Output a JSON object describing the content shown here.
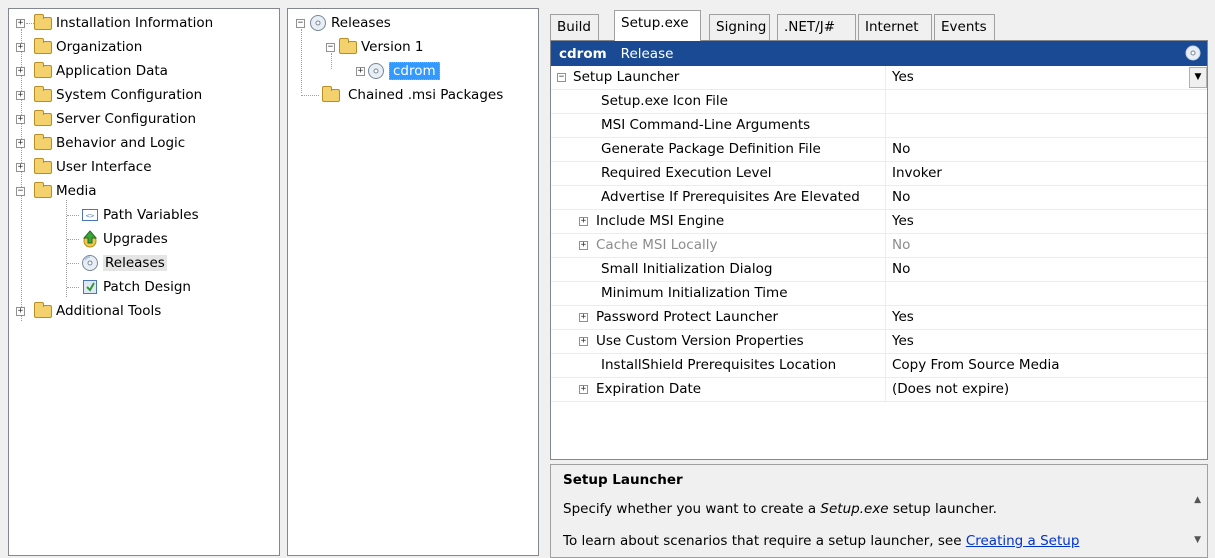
{
  "left_tree": {
    "items": [
      {
        "label": "Installation Information"
      },
      {
        "label": "Organization"
      },
      {
        "label": "Application Data"
      },
      {
        "label": "System Configuration"
      },
      {
        "label": "Server Configuration"
      },
      {
        "label": "Behavior and Logic"
      },
      {
        "label": "User Interface"
      },
      {
        "label": "Media"
      },
      {
        "label": "Path Variables"
      },
      {
        "label": "Upgrades"
      },
      {
        "label": "Releases"
      },
      {
        "label": "Patch Design"
      },
      {
        "label": "Additional Tools"
      }
    ]
  },
  "mid_tree": {
    "releases": "Releases",
    "version": "Version 1",
    "cdrom": "cdrom",
    "chained": "Chained .msi Packages"
  },
  "tabs": [
    "Build",
    "Setup.exe",
    "Signing",
    ".NET/J#",
    "Internet",
    "Events"
  ],
  "grid": {
    "header_title": "cdrom",
    "header_subtitle": "Release",
    "rows": [
      {
        "name": "Setup Launcher",
        "value": "Yes"
      },
      {
        "name": "Setup.exe Icon File",
        "value": ""
      },
      {
        "name": "MSI Command-Line Arguments",
        "value": ""
      },
      {
        "name": "Generate Package Definition File",
        "value": "No"
      },
      {
        "name": "Required Execution Level",
        "value": "Invoker"
      },
      {
        "name": "Advertise If Prerequisites Are Elevated",
        "value": "No"
      },
      {
        "name": "Include MSI Engine",
        "value": "Yes"
      },
      {
        "name": "Cache MSI Locally",
        "value": "No"
      },
      {
        "name": "Small Initialization Dialog",
        "value": "No"
      },
      {
        "name": "Minimum Initialization Time",
        "value": ""
      },
      {
        "name": "Password Protect Launcher",
        "value": "Yes"
      },
      {
        "name": "Use Custom Version Properties",
        "value": "Yes"
      },
      {
        "name": "InstallShield Prerequisites Location",
        "value": "Copy From Source Media"
      },
      {
        "name": "Expiration Date",
        "value": "(Does not expire)"
      }
    ]
  },
  "help": {
    "title": "Setup Launcher",
    "line1_pre": "Specify whether you want to create a ",
    "line1_em": "Setup.exe",
    "line1_post": " setup launcher.",
    "line2_pre": "To learn about scenarios that require a setup launcher, see ",
    "line2_link": "Creating a Setup"
  },
  "colors": {
    "header_bg": "#1a4a93",
    "selection_bg": "#3399ff",
    "link": "#0033cc"
  }
}
